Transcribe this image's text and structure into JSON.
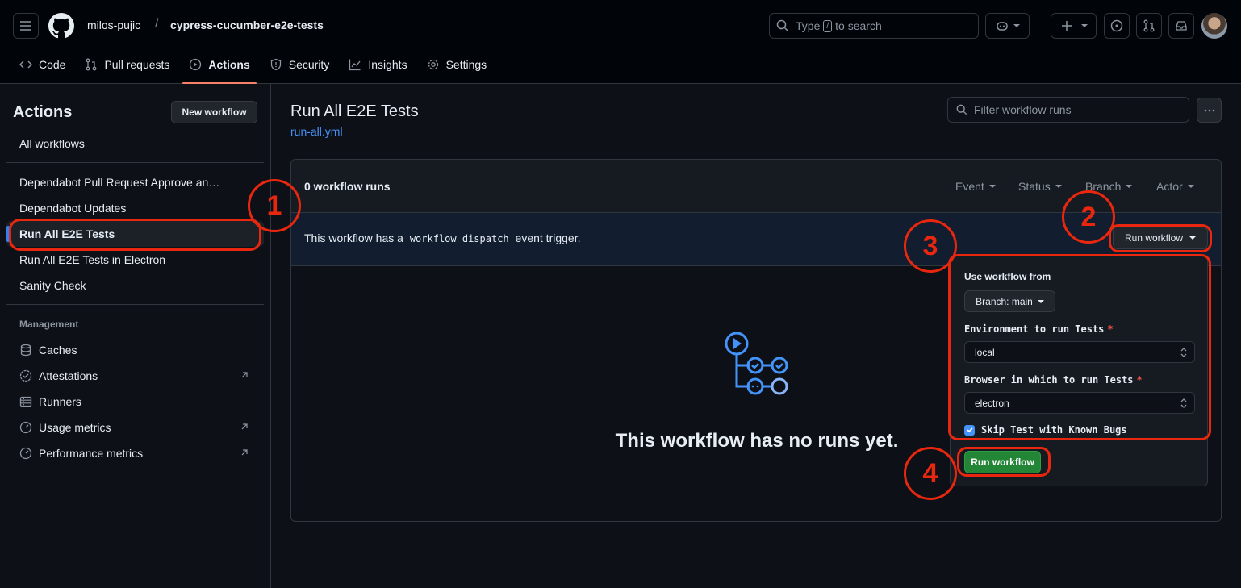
{
  "header": {
    "owner": "milos-pujic",
    "separator": "/",
    "repo": "cypress-cucumber-e2e-tests",
    "search_prefix": "Type",
    "search_key": "/",
    "search_suffix": "to search"
  },
  "tabs": [
    {
      "label": "Code",
      "icon": "code-icon"
    },
    {
      "label": "Pull requests",
      "icon": "pull-request-icon"
    },
    {
      "label": "Actions",
      "icon": "play-icon",
      "selected": true
    },
    {
      "label": "Security",
      "icon": "shield-icon"
    },
    {
      "label": "Insights",
      "icon": "graph-icon"
    },
    {
      "label": "Settings",
      "icon": "gear-icon"
    }
  ],
  "sidebar": {
    "title": "Actions",
    "new_workflow": "New workflow",
    "all_workflows": "All workflows",
    "workflows": [
      "Dependabot Pull Request Approve an…",
      "Dependabot Updates",
      "Run All E2E Tests",
      "Run All E2E Tests in Electron",
      "Sanity Check"
    ],
    "management_label": "Management",
    "management": [
      {
        "label": "Caches",
        "icon": "database-icon"
      },
      {
        "label": "Attestations",
        "icon": "verified-icon"
      },
      {
        "label": "Runners",
        "icon": "server-icon"
      },
      {
        "label": "Usage metrics",
        "icon": "meter-icon"
      },
      {
        "label": "Performance metrics",
        "icon": "meter-icon"
      }
    ]
  },
  "main": {
    "title": "Run All E2E Tests",
    "file": "run-all.yml",
    "filter_placeholder": "Filter workflow runs",
    "runs_count": "0 workflow runs",
    "filters": [
      "Event",
      "Status",
      "Branch",
      "Actor"
    ],
    "dispatch_prefix": "This workflow has a",
    "dispatch_code": "workflow_dispatch",
    "dispatch_suffix": "event trigger.",
    "run_workflow_button": "Run workflow",
    "empty_message": "This workflow has no runs yet."
  },
  "panel": {
    "use_workflow_from": "Use workflow from",
    "branch_button": "Branch: main",
    "env_label": "Environment to run Tests",
    "env_value": "local",
    "browser_label": "Browser in which to run Tests",
    "browser_value": "electron",
    "skip_label": "Skip Test with Known Bugs",
    "skip_checked": true,
    "submit": "Run workflow"
  },
  "annotations": [
    "1",
    "2",
    "3",
    "4"
  ],
  "colors": {
    "accent_blue": "#4493f8",
    "annotation_red": "#e8270e",
    "tab_underline": "#f78166",
    "green_button": "#238636"
  }
}
